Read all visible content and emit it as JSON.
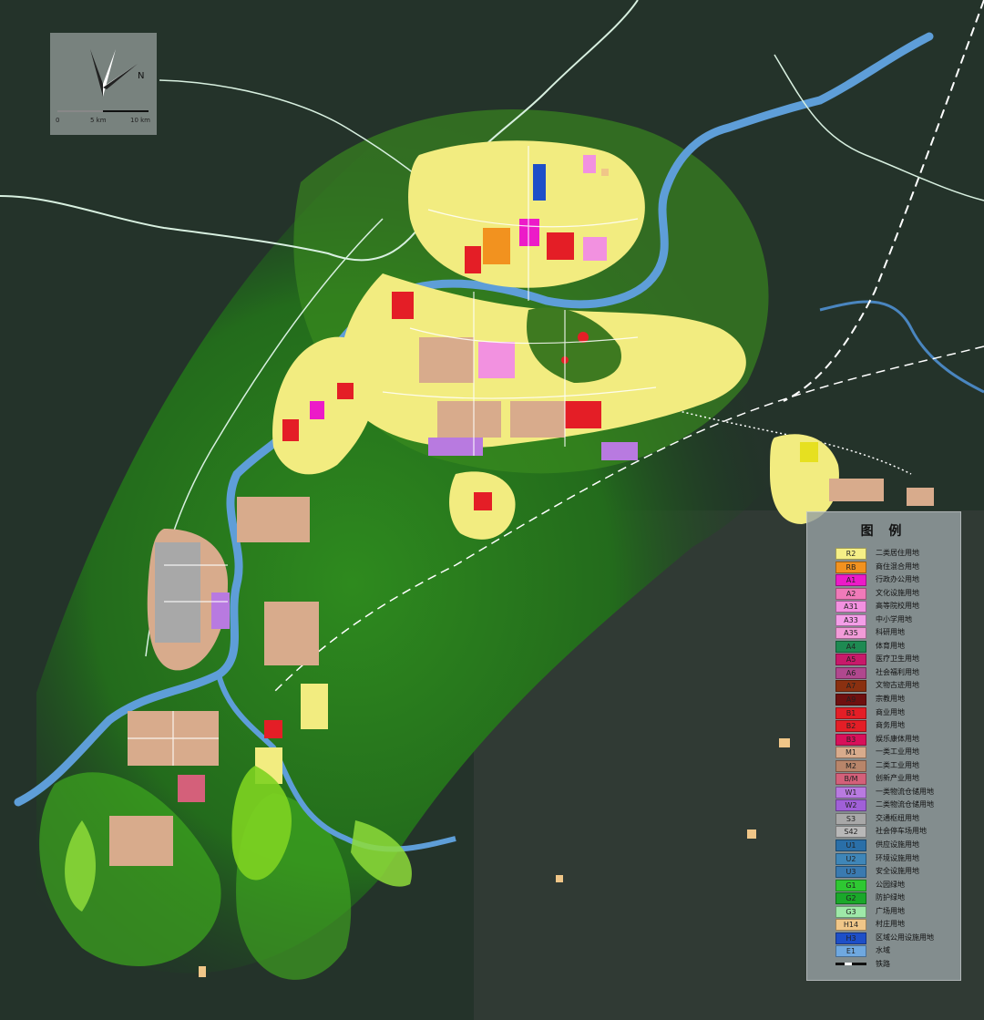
{
  "map": {
    "north_label": "N",
    "scale_labels": [
      "0",
      "5 km",
      "10 km"
    ],
    "legend_title": "图 例",
    "legend": [
      {
        "code": "R2",
        "label": "二类居住用地",
        "color": "#f5ef86"
      },
      {
        "code": "RB",
        "label": "商住混合用地",
        "color": "#f2921f"
      },
      {
        "code": "A1",
        "label": "行政办公用地",
        "color": "#ec1bc8"
      },
      {
        "code": "A2",
        "label": "文化设施用地",
        "color": "#f07ab9"
      },
      {
        "code": "A31",
        "label": "高等院校用地",
        "color": "#f291e0"
      },
      {
        "code": "A33",
        "label": "中小学用地",
        "color": "#f49ee8"
      },
      {
        "code": "A35",
        "label": "科研用地",
        "color": "#f29bd8"
      },
      {
        "code": "A4",
        "label": "体育用地",
        "color": "#1e8a52"
      },
      {
        "code": "A5",
        "label": "医疗卫生用地",
        "color": "#c8196a"
      },
      {
        "code": "A6",
        "label": "社会福利用地",
        "color": "#b0488e"
      },
      {
        "code": "A7",
        "label": "文物古迹用地",
        "color": "#8a3010"
      },
      {
        "code": "A9",
        "label": "宗教用地",
        "color": "#6e1010"
      },
      {
        "code": "B1",
        "label": "商业用地",
        "color": "#e41e26"
      },
      {
        "code": "B2",
        "label": "商务用地",
        "color": "#e41e26"
      },
      {
        "code": "B3",
        "label": "娱乐康体用地",
        "color": "#d8105a"
      },
      {
        "code": "M1",
        "label": "一类工业用地",
        "color": "#d8ab8c"
      },
      {
        "code": "M2",
        "label": "二类工业用地",
        "color": "#b8856a"
      },
      {
        "code": "B/M",
        "label": "创新产业用地",
        "color": "#d4607a"
      },
      {
        "code": "W1",
        "label": "一类物流仓储用地",
        "color": "#b87ae0"
      },
      {
        "code": "W2",
        "label": "二类物流仓储用地",
        "color": "#a060d8"
      },
      {
        "code": "S3",
        "label": "交通枢纽用地",
        "color": "#a8a8a8"
      },
      {
        "code": "S42",
        "label": "社会停车场用地",
        "color": "#b8b8b8"
      },
      {
        "code": "U1",
        "label": "供应设施用地",
        "color": "#2a6fa8"
      },
      {
        "code": "U2",
        "label": "环境设施用地",
        "color": "#3f86b8"
      },
      {
        "code": "U3",
        "label": "安全设施用地",
        "color": "#3a7ab0"
      },
      {
        "code": "G1",
        "label": "公园绿地",
        "color": "#2ec832"
      },
      {
        "code": "G2",
        "label": "防护绿地",
        "color": "#1aa82a"
      },
      {
        "code": "G3",
        "label": "广场用地",
        "color": "#9ee8a8"
      },
      {
        "code": "H14",
        "label": "村庄用地",
        "color": "#f0c688"
      },
      {
        "code": "H3",
        "label": "区域公用设施用地",
        "color": "#1e4fc8"
      },
      {
        "code": "E1",
        "label": "水域",
        "color": "#6fa8e0"
      }
    ],
    "railway_label": "铁路"
  }
}
